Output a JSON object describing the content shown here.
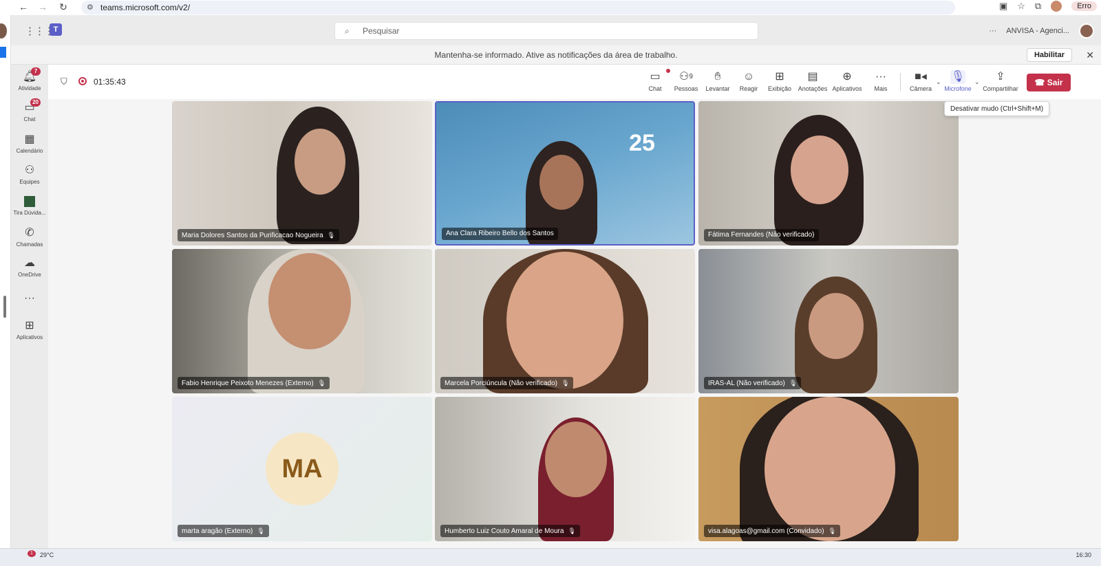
{
  "browser": {
    "url": "teams.microsoft.com/v2/",
    "profile_status": "Erro"
  },
  "header": {
    "search_placeholder": "Pesquisar",
    "org_name": "ANVISA - Agenci...",
    "more": "···"
  },
  "notification": {
    "text": "Mantenha-se informado. Ative as notificações da área de trabalho.",
    "button": "Habilitar"
  },
  "rail": {
    "items": [
      {
        "label": "Atividade",
        "icon": "bell-icon",
        "badge": "7"
      },
      {
        "label": "Chat",
        "icon": "chat-icon",
        "badge": "20"
      },
      {
        "label": "Calendário",
        "icon": "calendar-icon",
        "badge": ""
      },
      {
        "label": "Equipes",
        "icon": "teams-icon",
        "badge": ""
      },
      {
        "label": "Tira Dúvida...",
        "icon": "app-icon",
        "badge": ""
      },
      {
        "label": "Chamadas",
        "icon": "phone-icon",
        "badge": ""
      },
      {
        "label": "OneDrive",
        "icon": "cloud-icon",
        "badge": ""
      },
      {
        "label": "···",
        "icon": "more-icon",
        "badge": ""
      },
      {
        "label": "Aplicativos",
        "icon": "add-icon",
        "badge": ""
      }
    ]
  },
  "meeting": {
    "elapsed": "01:35:43",
    "toolbar": {
      "chat": "Chat",
      "people": "Pessoas",
      "people_count": "9",
      "raise": "Levantar",
      "react": "Reagir",
      "view": "Exibição",
      "notes": "Anotações",
      "apps": "Aplicativos",
      "more": "Mais",
      "camera": "Câmera",
      "mic": "Microfone",
      "share": "Compartilhar",
      "leave": "Sair"
    },
    "tooltip": "Desativar mudo (Ctrl+Shift+M)"
  },
  "participants": [
    {
      "name": "Maria Dolores Santos da Purificacao Nogueira",
      "muted": true
    },
    {
      "name": "Ana Clara Ribeiro Bello dos Santos",
      "muted": false
    },
    {
      "name": "Fátima Fernandes (Não verificado)",
      "muted": false
    },
    {
      "name": "Fabio Henrique Peixoto Menezes (Externo)",
      "muted": true
    },
    {
      "name": "Marcela Porciúncula (Não verificado)",
      "muted": true
    },
    {
      "name": "IRAS-AL (Não verificado)",
      "muted": true
    },
    {
      "name": "marta aragão (Externo)",
      "muted": true,
      "initials": "MA"
    },
    {
      "name": "Humberto Luiz Couto Amaral de Moura",
      "muted": true
    },
    {
      "name": "visa.alagoas@gmail.com (Convidado)",
      "muted": true
    }
  ],
  "video_overlay": {
    "logo_number": "25"
  },
  "taskbar": {
    "weather": "29°C",
    "weather_badge": "1",
    "clock": "16:30"
  }
}
